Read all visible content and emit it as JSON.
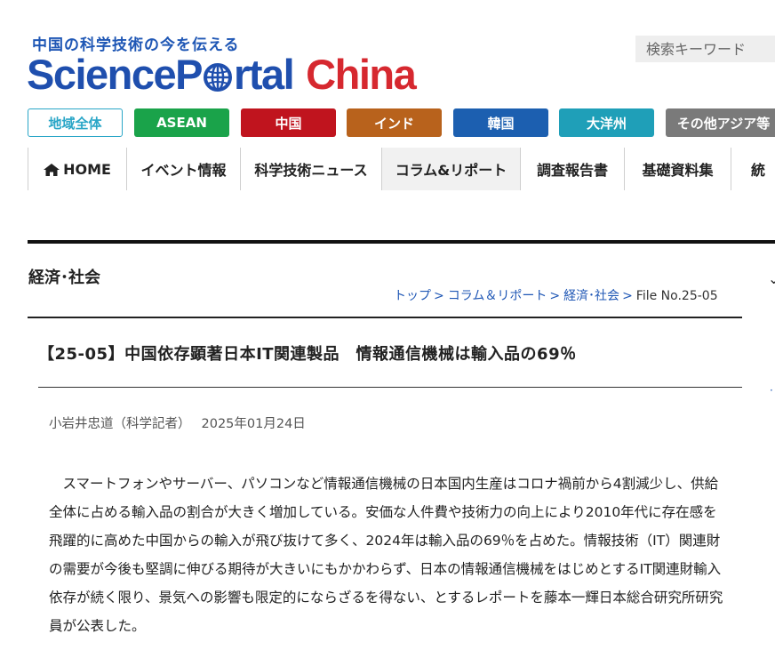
{
  "header": {
    "tagline": "中国の科学技術の今を伝える",
    "logo_part1": "ScienceP",
    "logo_part2": "rtal",
    "logo_part3": "China",
    "search_placeholder": "検索キーワード"
  },
  "regions": [
    {
      "label": "地域全体"
    },
    {
      "label": "ASEAN"
    },
    {
      "label": "中国"
    },
    {
      "label": "インド"
    },
    {
      "label": "韓国"
    },
    {
      "label": "大洋州"
    },
    {
      "label": "その他アジア等"
    }
  ],
  "nav": [
    {
      "label": "HOME",
      "icon": "home-icon"
    },
    {
      "label": "イベント情報"
    },
    {
      "label": "科学技術ニュース"
    },
    {
      "label": "コラム&リポート"
    },
    {
      "label": "調査報告書"
    },
    {
      "label": "基礎資料集"
    },
    {
      "label": "統"
    }
  ],
  "section": {
    "title": "経済･社会"
  },
  "breadcrumb": {
    "top": "トップ",
    "column": "コラム＆リポート",
    "econ": "経済･社会",
    "file": "File No.25-05",
    "sep": ">"
  },
  "article": {
    "title": "【25-05】中国依存顕著日本IT関連製品　情報通信機械は輸入品の69％",
    "author": "小岩井忠道（科学記者）",
    "date": "2025年01月24日",
    "body": "　スマートフォンやサーバー、パソコンなど情報通信機械の日本国内生産はコロナ禍前から4割減少し、供給全体に占める輸入品の割合が大きく増加している。安価な人件費や技術力の向上により2010年代に存在感を飛躍的に高めた中国からの輸入が飛び抜けて多く、2024年は輸入品の69％を占めた。情報技術（IT）関連財の需要が今後も堅調に伸びる期待が大きいにもかかわらず、日本の情報通信機械をはじめとするIT関連財輸入依存が続く限り、景気への影響も限定的にならざるを得ない、とするレポートを藤本一輝日本総合研究所研究員が公表した。"
  },
  "colors": {
    "brand_blue": "#1f4fae",
    "brand_red": "#d6282f",
    "link_blue": "#1f57b5"
  }
}
